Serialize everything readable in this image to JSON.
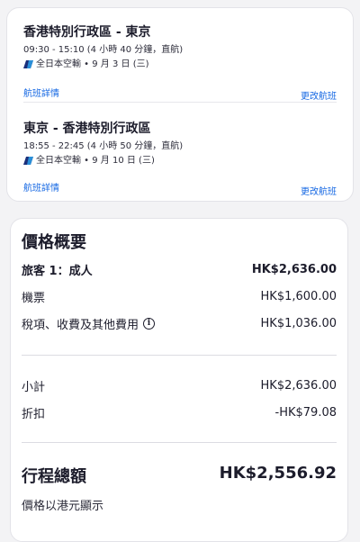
{
  "flights": [
    {
      "route": "香港特別行政區 - 東京",
      "times": "09:30 - 15:10 (4 小時 40 分鐘，直航)",
      "airline": "全日本空輸 • 9 月 3 日 (三)",
      "details_link": "航班詳情",
      "change_link": "更改航班"
    },
    {
      "route": "東京 - 香港特別行政區",
      "times": "18:55 - 22:45 (4 小時 50 分鐘，直航)",
      "airline": "全日本空輸 • 9 月 10 日 (三)",
      "details_link": "航班詳情",
      "change_link": "更改航班"
    }
  ],
  "price_summary": {
    "title": "價格概要",
    "traveler_label": "旅客 1：成人",
    "traveler_value": "HK$2,636.00",
    "ticket_label": "機票",
    "ticket_value": "HK$1,600.00",
    "taxes_label": "稅項、收費及其他費用",
    "taxes_value": "HK$1,036.00",
    "subtotal_label": "小計",
    "subtotal_value": "HK$2,636.00",
    "discount_label": "折扣",
    "discount_value": "-HK$79.08",
    "total_label": "行程總額",
    "total_value": "HK$2,556.92",
    "currency_note": "價格以港元顯示"
  },
  "colors": {
    "link": "#1668e3",
    "text": "#1c1c2b",
    "airline_logo_dark": "#1b2f7a",
    "airline_logo_light": "#2a8fd8"
  },
  "icons": {
    "airline_logo": "ana-logo-icon",
    "info": "info-icon"
  }
}
